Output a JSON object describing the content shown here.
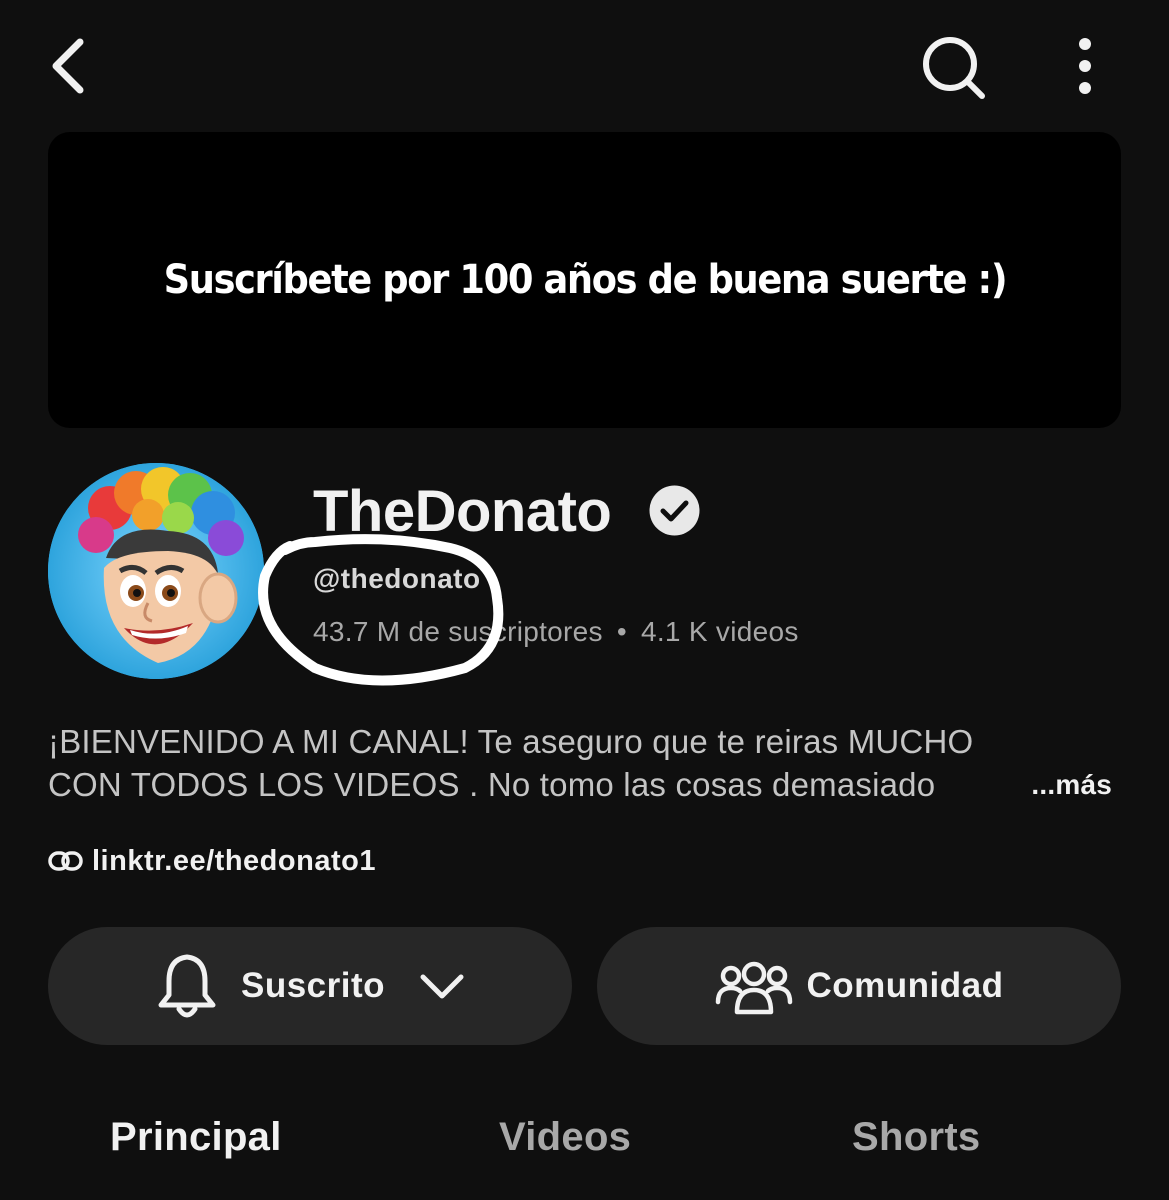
{
  "banner": {
    "text": "Suscríbete por 100 años de buena suerte :)"
  },
  "channel": {
    "name": "TheDonato",
    "handle": "@thedonato",
    "subscribers": "43.7 M de suscriptores",
    "separator": "•",
    "videos": "4.1 K videos",
    "verified": true
  },
  "description": {
    "line1": "¡BIENVENIDO A MI CANAL! Te aseguro que te reiras MUCHO",
    "line2": "CON TODOS LOS VIDEOS . No tomo las cosas demasiado",
    "more_label": "...más"
  },
  "link": {
    "text": "linktr.ee/thedonato1"
  },
  "actions": {
    "subscribe_label": "Suscrito",
    "community_label": "Comunidad"
  },
  "tabs": [
    {
      "label": "Principal",
      "active": true
    },
    {
      "label": "Videos",
      "active": false
    },
    {
      "label": "Shorts",
      "active": false
    }
  ],
  "icons": {
    "back": "chevron-left-icon",
    "search": "search-icon",
    "more": "more-vertical-icon",
    "verified": "verified-check-icon",
    "link": "link-icon",
    "bell": "bell-icon",
    "chevron": "chevron-down-icon",
    "community": "people-icon"
  },
  "colors": {
    "background": "#0f0f0f",
    "button": "#272727",
    "text_primary": "#f1f1f1",
    "text_secondary": "#a8a8a8"
  }
}
